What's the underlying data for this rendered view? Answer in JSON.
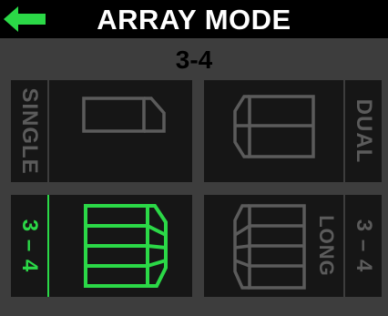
{
  "header": {
    "title": "ARRAY MODE",
    "back_icon": "back-arrow-icon",
    "colors": {
      "background": "#000000",
      "text": "#ffffff",
      "accent": "#2bd847"
    }
  },
  "current_mode": "3-4",
  "options": {
    "single": {
      "label": "SINGLE",
      "selected": false,
      "icon": "single-speaker-icon"
    },
    "dual": {
      "label": "DUAL",
      "selected": false,
      "icon": "dual-speaker-icon"
    },
    "three_four": {
      "label": "3 – 4",
      "selected": true,
      "icon": "array-3-4-speaker-icon"
    },
    "three_four_long": {
      "label_top": "LONG",
      "label_side": "3 – 4",
      "selected": false,
      "icon": "array-3-4-long-speaker-icon"
    }
  },
  "colors": {
    "panel_bg": "#3d3d3d",
    "tile_bg": "#161616",
    "inactive": "#5b5b5b",
    "active": "#2bd847"
  }
}
